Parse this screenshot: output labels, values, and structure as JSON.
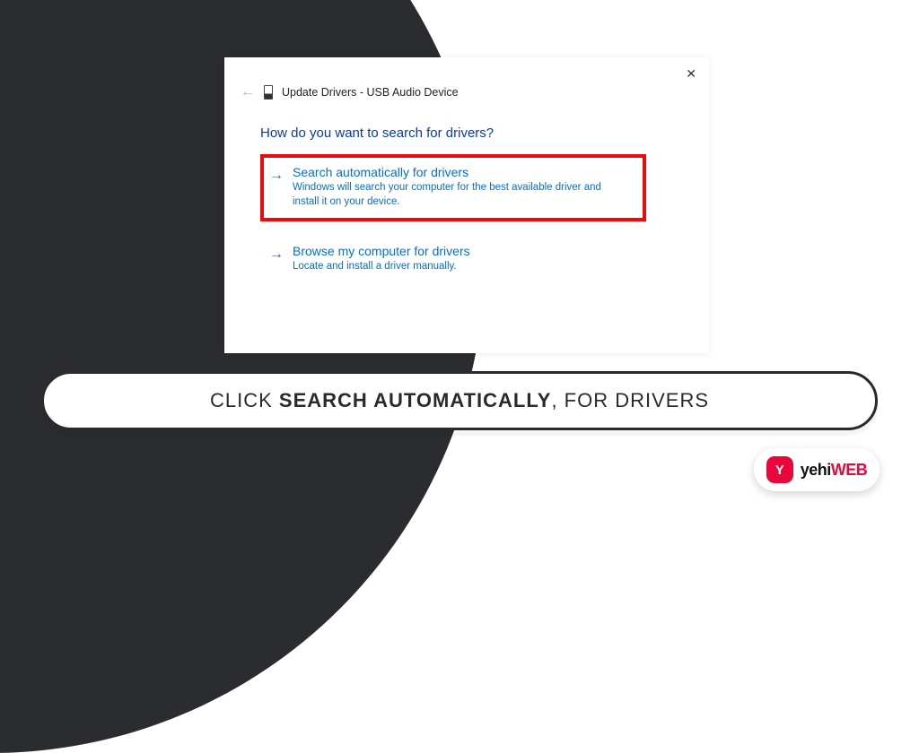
{
  "dialog": {
    "title": "Update Drivers - USB Audio Device",
    "question": "How do you want to search for drivers?",
    "options": [
      {
        "title": "Search automatically for drivers",
        "desc": "Windows will search your computer for the best available driver and install it on your device."
      },
      {
        "title": "Browse my computer for drivers",
        "desc": "Locate and install a driver manually."
      }
    ]
  },
  "caption": {
    "pre": "CLICK ",
    "bold": "SEARCH AUTOMATICALLY",
    "post": ", FOR DRIVERS"
  },
  "brand": {
    "icon_letter": "Y",
    "name_a": "yehi",
    "name_b": "WEB"
  }
}
